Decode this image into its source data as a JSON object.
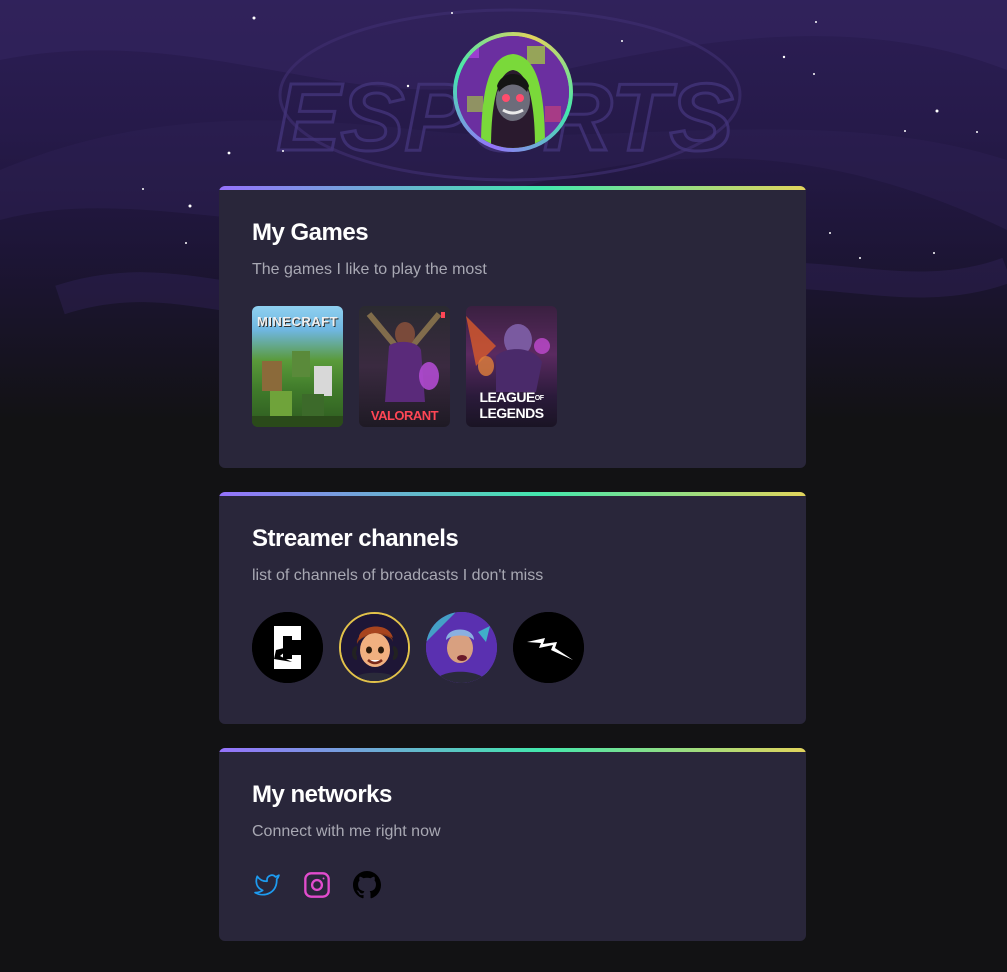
{
  "background": {
    "watermark": "ESPORTS"
  },
  "profile": {
    "avatar": "hooded-character-avatar"
  },
  "games_card": {
    "title": "My Games",
    "subtitle": "The games I like to play the most",
    "games": [
      {
        "name": "minecraft",
        "label": "MINECRAFT"
      },
      {
        "name": "valorant",
        "label": "VALORANT"
      },
      {
        "name": "league-of-legends",
        "label_line1": "LEAGUE",
        "label_of": "OF",
        "label_line2": "LEGENDS"
      }
    ]
  },
  "streamers_card": {
    "title": "Streamer channels",
    "subtitle": "list of channels of broadcasts I don't miss",
    "channels": [
      "channel-logo-c",
      "cartoon-avatar",
      "photo-avatar",
      "lightning-logo"
    ]
  },
  "networks_card": {
    "title": "My networks",
    "subtitle": "Connect with me right now",
    "icons": [
      "twitter-icon",
      "instagram-icon",
      "github-icon"
    ]
  },
  "colors": {
    "accent_purple": "#9572fc",
    "accent_green": "#43e7ad",
    "accent_yellow": "#e2d45c",
    "card_bg": "#29263a",
    "twitter": "#1d9bf0",
    "instagram": "#e24ccd"
  }
}
